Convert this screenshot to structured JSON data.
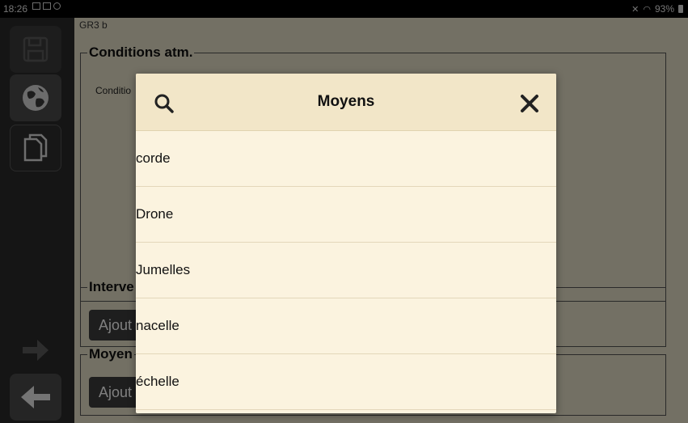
{
  "status_bar": {
    "time": "18:26",
    "battery": "93%"
  },
  "background": {
    "header_text": "GR3 b",
    "conditions": {
      "legend": "Conditions atm.",
      "label": "Conditio"
    },
    "intervenants": {
      "legend": "Interve",
      "add_label": "Ajout"
    },
    "moyens": {
      "legend": "Moyen",
      "add_label": "Ajout"
    }
  },
  "modal": {
    "title": "Moyens",
    "items": [
      {
        "label": "corde"
      },
      {
        "label": "Drone"
      },
      {
        "label": "Jumelles"
      },
      {
        "label": "nacelle"
      },
      {
        "label": "échelle"
      }
    ]
  }
}
